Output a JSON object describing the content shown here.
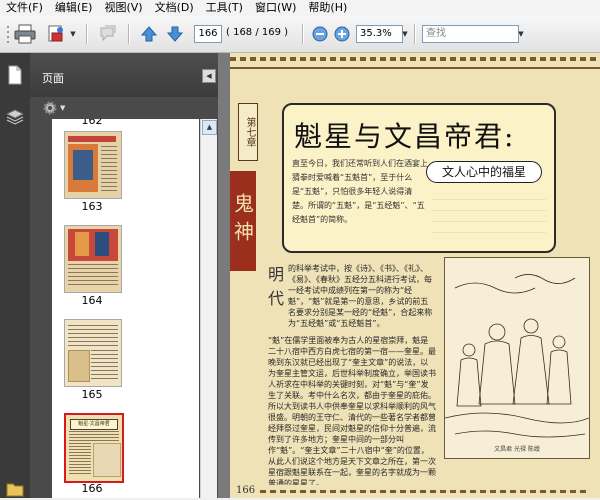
{
  "menu": [
    "文件(F)",
    "编辑(E)",
    "视图(V)",
    "文档(D)",
    "工具(T)",
    "窗口(W)",
    "帮助(H)"
  ],
  "toolbar": {
    "page_number": "166",
    "page_count": "( 168 / 169 )",
    "zoom": "35.3%",
    "search_placeholder": "查找"
  },
  "nav_panel": {
    "title": "页面",
    "thumbnails": [
      {
        "label": "163",
        "selected": false
      },
      {
        "label": "164",
        "selected": false
      },
      {
        "label": "165",
        "selected": false
      },
      {
        "label": "166",
        "selected": true
      }
    ]
  },
  "document": {
    "chapter_tag": "第七章",
    "title": "魁星与文昌帝君:",
    "subtitle": "文人心中的福星",
    "side_title": "鬼神",
    "intro": "直至今日，我们还常听到人们在酒宴上猜拳时爱喊着“五魁首”，至于什么是“五魁”，只怕很多年轻人说得清楚。所谓的“五魁”，是“五经魁”、“五经魁首”的简称。",
    "era_heading": "明代",
    "body_1": "的科举考试中，按《诗》、《书》、《礼》、《易》、《春秋》五经分五科进行考试，每一经考试中成绩列在第一的称为“经魁”，“魁”就是第一的意思，乡试的前五名要求分别是某一经的“经魁”，合起来称为“五经魁”或“五经魁首”。",
    "body_2": "“魁”在儒学里面被奉为古人的星宿崇拜，魁是二十八宿中西方白虎七宿的第一宿——奎星。最晚到东汉就已经出现了“奎主文章”的说法，以为奎星主管文运，后世科举制度确立，举国读书人祈求在中科举的关键时刻，对“魁”与“奎”发生了关联。考中什么名次，都由于奎星的庇佑。所以大到读书人中供奉奎星以求科举顺利的风气很盛。明朝的王守仁、清代的一些著名学者都曾经拜祭过奎星，民间对魁星的信仰十分普遍，流传到了许多地方；奎星中间的一部分叫作“魁”。“奎主文章”二十八宿中“奎”的位置，从此人们说这个地方是天下文章之所在，第一次星宿跟魁星联系在一起，奎星的名字就成为一颗普通的星星了。",
    "caption": "文昌君  光禄  陈绶",
    "page_num": "166"
  }
}
